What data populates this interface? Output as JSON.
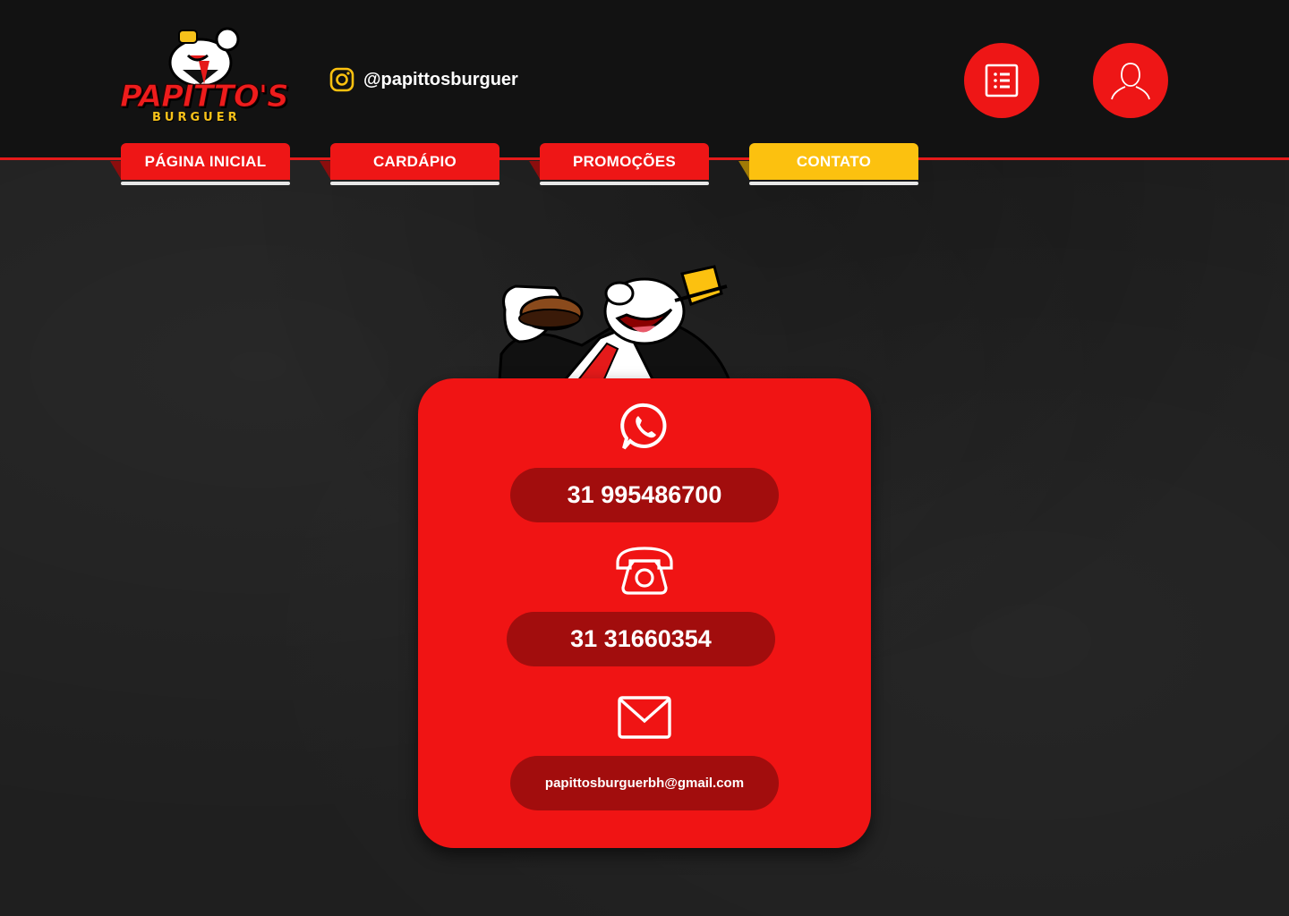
{
  "brand": {
    "name": "PAPITTO'S",
    "sub": "BURGUER",
    "colors": {
      "red": "#ee1616",
      "yellow": "#fcc10f",
      "dark": "#121212"
    }
  },
  "header": {
    "instagram": {
      "icon": "instagram-icon",
      "handle": "@papittosburguer"
    },
    "buttons": [
      {
        "name": "menu-list-button",
        "icon": "list-icon"
      },
      {
        "name": "user-account-button",
        "icon": "user-icon"
      }
    ]
  },
  "nav": {
    "tabs": [
      {
        "label": "PÁGINA INICIAL",
        "active": false
      },
      {
        "label": "CARDÁPIO",
        "active": false
      },
      {
        "label": "PROMOÇÕES",
        "active": false
      },
      {
        "label": "CONTATO",
        "active": true
      }
    ]
  },
  "contact": {
    "whatsapp": {
      "icon": "whatsapp-icon",
      "value": "31 995486700"
    },
    "phone": {
      "icon": "telephone-icon",
      "value": "31 31660354"
    },
    "email": {
      "icon": "mail-icon",
      "value": "papittosburguerbh@gmail.com"
    }
  }
}
